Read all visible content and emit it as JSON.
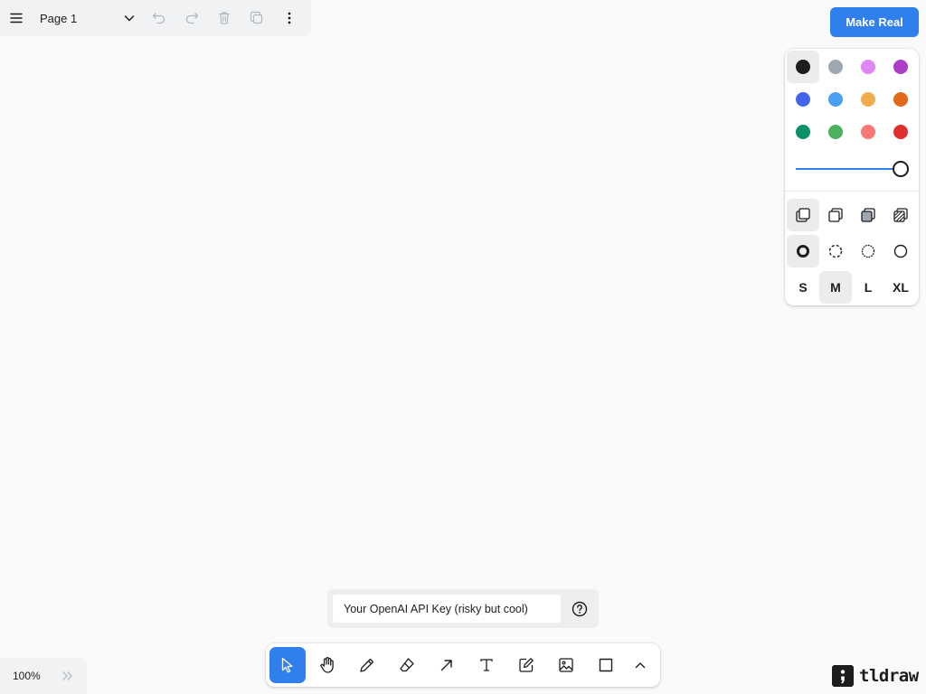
{
  "menu": {
    "page_name": "Page 1",
    "icons": [
      "hamburger-menu-icon",
      "chevron-down-icon",
      "undo-icon",
      "redo-icon",
      "trash-icon",
      "duplicate-icon",
      "more-vertical-icon"
    ]
  },
  "make_real": {
    "label": "Make Real",
    "color": "#2f80ed"
  },
  "style_panel": {
    "colors": [
      {
        "name": "black",
        "hex": "#1d1d1d",
        "selected": true
      },
      {
        "name": "grey",
        "hex": "#9fa8b2"
      },
      {
        "name": "light-violet",
        "hex": "#e085f4"
      },
      {
        "name": "violet",
        "hex": "#ae3ec9"
      },
      {
        "name": "blue",
        "hex": "#4465e9"
      },
      {
        "name": "light-blue",
        "hex": "#4ba1f1"
      },
      {
        "name": "yellow",
        "hex": "#f1ac4b"
      },
      {
        "name": "orange",
        "hex": "#e16919"
      },
      {
        "name": "green",
        "hex": "#099268"
      },
      {
        "name": "light-green",
        "hex": "#4cb05e"
      },
      {
        "name": "light-red",
        "hex": "#f87777"
      },
      {
        "name": "red",
        "hex": "#e03131"
      }
    ],
    "opacity": 1.0,
    "fill_icons": [
      "fill-none-icon",
      "fill-semi-icon",
      "fill-solid-icon",
      "fill-pattern-icon"
    ],
    "dash_icons": [
      "dash-draw-icon",
      "dash-dashed-icon",
      "dash-dotted-icon",
      "dash-solid-icon"
    ],
    "sizes": [
      "S",
      "M",
      "L",
      "XL"
    ],
    "selected_size": "M"
  },
  "api_key": {
    "placeholder": "Your OpenAI API Key (risky but cool)"
  },
  "toolbar": {
    "tools": [
      "select-icon",
      "hand-icon",
      "draw-icon",
      "eraser-icon",
      "arrow-icon",
      "text-icon",
      "note-icon",
      "image-icon",
      "rectangle-icon",
      "chevron-up-icon"
    ],
    "active": "select"
  },
  "zoom": {
    "level": "100%"
  },
  "logo": {
    "text": "tldraw"
  }
}
